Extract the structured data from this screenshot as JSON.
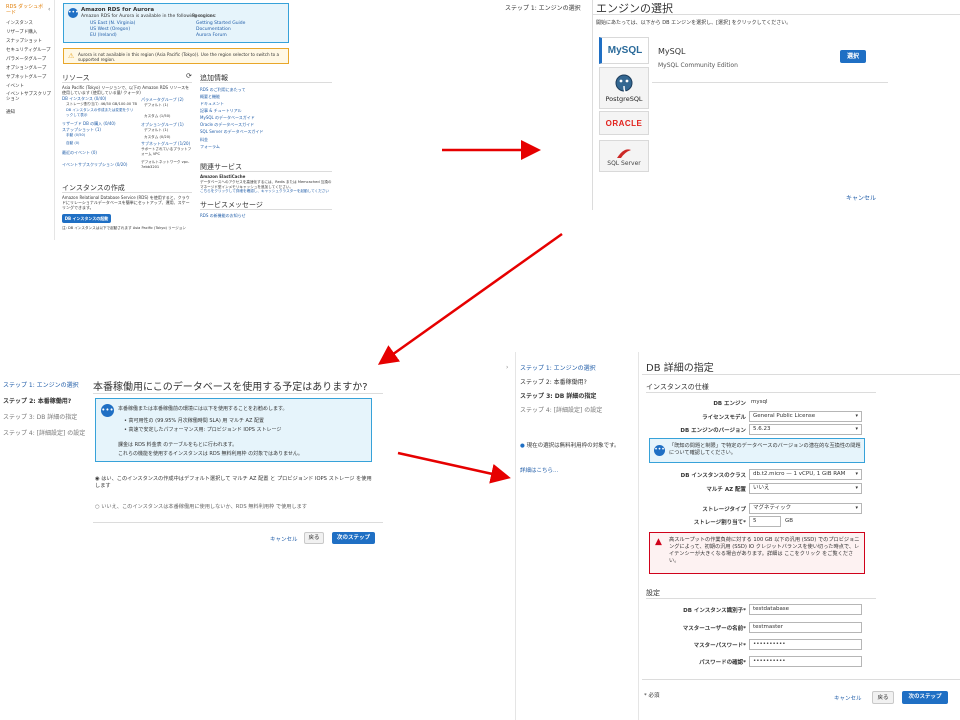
{
  "dashboard": {
    "sidebar_title": "RDS ダッシュボード",
    "sidebar_items": [
      "インスタンス",
      "リザーブド購入",
      "スナップショット",
      "セキュリティグループ",
      "パラメータグループ",
      "オプショングループ",
      "サブネットグループ",
      "イベント",
      "イベントサブスクリプション",
      "通知"
    ],
    "aurora_title": "Amazon RDS for Aurora",
    "aurora_desc": "Amazon RDS for Aurora is available in the following regions:",
    "aurora_regions": [
      "US East (N. Virginia)",
      "US West (Oregon)",
      "EU (Ireland)"
    ],
    "resources_title": "Resources",
    "resources_links": [
      "Getting Started Guide",
      "Documentation",
      "Aurora Forum"
    ],
    "warning_text": "Aurora is not available in this region (Asia Pacific (Tokyo)). Use the region selector to switch to a supported region.",
    "resources_heading": "リソース",
    "resources_intro": "Asia Pacific (Tokyo) リージョンで、以下の Amazon RDS リソースを使用しています (使用している量/ クォータ)",
    "resources_left": [
      "DB インスタンス (0/40)",
      "ストレージ割り当て: 46/30 GB/100.00 TB",
      "DB インスタンスの作成または変更をクリックして表示",
      "リザーブド DB の購入 (0/40)",
      "スナップショット (1)",
      "手動 (0/50)",
      "自動 (0)",
      "最近のイベント (0)",
      "イベントサブスクリプション (0/20)"
    ],
    "resources_right": [
      "パラメータグループ (2)",
      "デフォルト (1)",
      "カスタム (1/50)",
      "オプショングループ (1)",
      "デフォルト (1)",
      "カスタム (0/20)",
      "サブネットグループ (1/20)",
      "サポートされているプラットフォーム VPC",
      "デフォルトネットワーク vpc-7ebb3201"
    ],
    "create_heading": "インスタンスの作成",
    "create_desc": "Amazon Relational Database Service (RDS) を使用すると、クラウドにリレーショナルデータベースを簡単にセットアップ、運用、スケーリングできます。",
    "create_button": "DB インスタンスの起動",
    "create_note": "注: DB インスタンスは以下で起動されます Asia Pacific (Tokyo) リージョン",
    "info_heading": "追加情報",
    "info_links": [
      "RDS のご利用にあたって",
      "概要と機能",
      "ドキュメント",
      "記事 & チュートリアル",
      "MySQL のデータベースガイド",
      "Oracle のデータベースガイド",
      "SQL Server のデータベースガイド",
      "料金",
      "フォーラム"
    ],
    "services_heading": "関連サービス",
    "elasticache_title": "Amazon ElastiCache",
    "elasticache_desc": "データベースへのアクセスを高速化するには、Redis または Memcached 互換のマネージド型インメモリキャッシュを追加してください。",
    "elasticache_link": "こちらをクリックして詳細を確認し、キャッシュクラスターを起動してください",
    "msg_heading": "サービスメッセージ",
    "msg_link": "RDS の新機能のお知らせ"
  },
  "engine": {
    "step_label": "ステップ 1: エンジンの選択",
    "title": "エンジンの選択",
    "instruction": "開始にあたっては、以下から DB エンジンを選択し、[選択] をクリックしてください。",
    "logos": [
      "MySQL",
      "PostgreSQL",
      "ORACLE",
      "SQL Server"
    ],
    "selected_name": "MySQL",
    "selected_edition": "MySQL Community Edition",
    "select_button": "選択",
    "cancel": "キャンセル"
  },
  "production": {
    "steps": [
      "ステップ 1: エンジンの選択",
      "ステップ 2: 本番稼働用?",
      "ステップ 3: DB 詳細の指定",
      "ステップ 4: [詳細設定] の設定"
    ],
    "title": "本番稼働用にこのデータベースを使用する予定はありますか?",
    "info_lead": "本番稼働または本番稼働前の環境には以下を使用することをお勧めします。",
    "bullet1": "高可用性の (99.95% 月次稼働時間 SLA) 用 マルチ AZ 配置",
    "bullet2": "高速で安定したパフォーマンス用: プロビジョンド IOPS ストレージ",
    "billing1": "課金は RDS 料金表 のテーブルをもとに行われます。",
    "billing2": "これらの機能を使用するインスタンスは RDS 無料利用枠 の対象ではありません。",
    "yes_option": "はい、このインスタンスの作成中はデフォルト選択して マルチ AZ 配置 と プロビジョンド IOPS ストレージ を使用します",
    "no_option": "いいえ、このインスタンスは本番稼働用に使用しないか、RDS 無料利用枠 で使用します",
    "cancel": "キャンセル",
    "back": "戻る",
    "next": "次のステップ"
  },
  "details": {
    "steps": [
      "ステップ 1: エンジンの選択",
      "ステップ 2: 本番稼働用?",
      "ステップ 3: DB 詳細の指定",
      "ステップ 4: [詳細設定] の設定"
    ],
    "free_tier_note": "現在の選択は無料利用枠の対象です。",
    "learn_more": "詳細はこちら...",
    "title": "DB 詳細の指定",
    "spec_heading": "インスタンスの仕様",
    "engine_label": "DB エンジン",
    "engine_value": "mysql",
    "license_label": "ライセンスモデル",
    "license_value": "General Public License",
    "version_label": "DB エンジンのバージョン",
    "version_value": "5.6.23",
    "known_issues": "「既知の問題と制限」で特定のデータベースのバージョンの潜在的な互換性の問題について確認してください。",
    "class_label": "DB インスタンスのクラス",
    "class_value": "db.t2.micro — 1 vCPU, 1 GiB RAM",
    "multiaz_label": "マルチ AZ 配置",
    "multiaz_value": "いいえ",
    "storage_type_label": "ストレージタイプ",
    "storage_type_value": "マグネティック",
    "storage_label": "ストレージ割り当て*",
    "storage_value": "5",
    "storage_unit": "GB",
    "warning": "高スループットの作業負荷に対する 100 GB 以下の汎用 (SSD) でのプロビジョニングによって、初期の汎用 (SSD) IO クレジットバランスを使い切った時点で、レイテンシーが大きくなる場合があります。詳細は ここをクリック をご覧ください。",
    "settings_heading": "設定",
    "id_label": "DB インスタンス識別子*",
    "id_value": "testdatabase",
    "user_label": "マスターユーザーの名前*",
    "user_value": "testmaster",
    "pw_label": "マスターパスワード*",
    "pw_value": "••••••••••",
    "pw2_label": "パスワードの確認*",
    "pw2_value": "••••••••••",
    "required": "* 必須",
    "cancel": "キャンセル",
    "back": "戻る",
    "next": "次のステップ"
  },
  "colors": {
    "accent": "#1f6fc4",
    "arrow": "#e60000",
    "info_bg": "#e6f4fb",
    "info_border": "#37a2d9",
    "warn_bg": "#fff8e5",
    "warn_border": "#e8a72a",
    "danger": "#d0021b"
  }
}
